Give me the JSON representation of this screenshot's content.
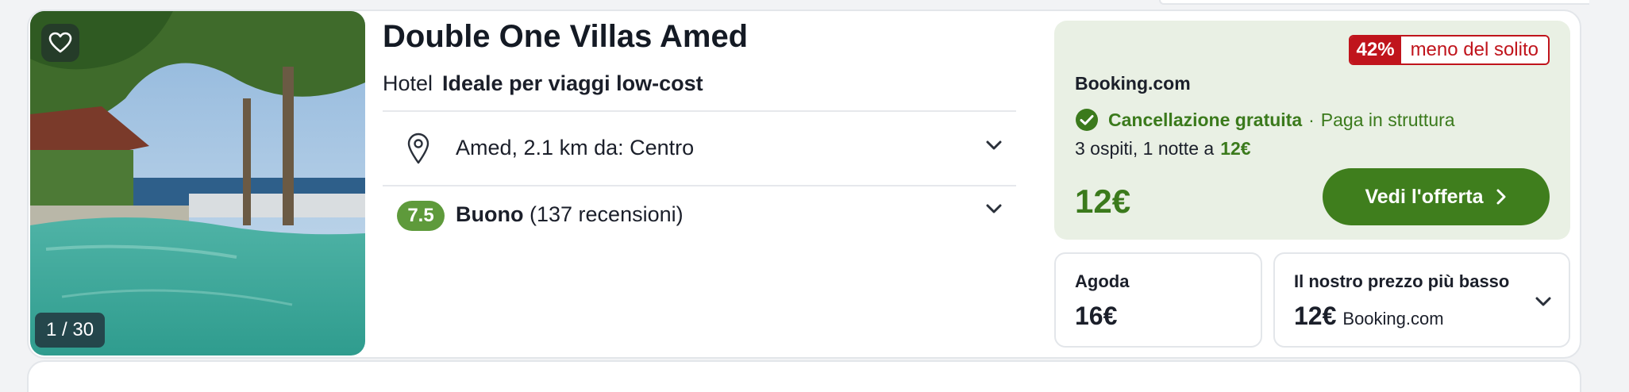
{
  "photo": {
    "counter": "1 / 30",
    "favorite_icon": "heart-icon"
  },
  "hotel": {
    "name": "Double One Villas Amed",
    "type": "Hotel",
    "tag": "Ideale per viaggi low-cost",
    "location": "Amed, 2.1 km da: Centro",
    "rating": {
      "score": "7.5",
      "label": "Buono",
      "reviews": "(137 recensioni)"
    }
  },
  "deal": {
    "discount_pct": "42%",
    "discount_text": "meno del solito",
    "provider": "Booking.com",
    "free_cancel": "Cancellazione gratuita",
    "separator": "·",
    "pay_text": "Paga in struttura",
    "guests_text": "3 ospiti, 1 notte a",
    "guests_price": "12€",
    "price": "12€",
    "cta": "Vedi l'offerta"
  },
  "alternatives": [
    {
      "provider": "Agoda",
      "price": "16€"
    },
    {
      "label": "Il nostro prezzo più basso",
      "price": "12€",
      "provider": "Booking.com"
    }
  ],
  "colors": {
    "accent_green": "#3f7e1d",
    "score_green": "#5e9a3b",
    "discount_red": "#c0141c",
    "deal_bg": "#e9f0e4"
  }
}
